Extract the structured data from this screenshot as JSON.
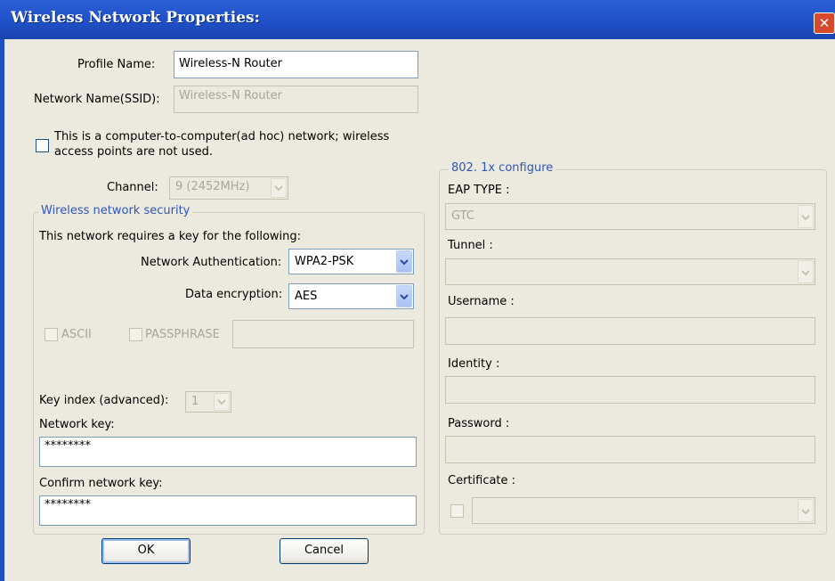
{
  "window": {
    "title": "Wireless Network Properties:",
    "close_glyph": "✕"
  },
  "profile": {
    "label": "Profile Name:",
    "value": "Wireless-N Router"
  },
  "ssid": {
    "label": "Network Name(SSID):",
    "value": "Wireless-N Router"
  },
  "adhoc": {
    "line1": "This is a computer-to-computer(ad hoc) network; wireless",
    "line2": "access points are not used.",
    "checked": false
  },
  "channel": {
    "label": "Channel:",
    "value": "9  (2452MHz)"
  },
  "security": {
    "legend": "Wireless network security",
    "requires_text": "This network requires a key for the following:",
    "auth_label": "Network Authentication:",
    "auth_value": "WPA2-PSK",
    "enc_label": "Data encryption:",
    "enc_value": "AES",
    "ascii_label": "ASCII",
    "passphrase_label": "PASSPHRASE",
    "passphrase_value": "",
    "key_index_label": "Key index (advanced):",
    "key_index_value": "1",
    "network_key_label": "Network key:",
    "network_key_value": "********",
    "confirm_key_label": "Confirm network key:",
    "confirm_key_value": "********"
  },
  "eap": {
    "legend": "802. 1x configure",
    "eap_type_label": "EAP TYPE :",
    "eap_type_value": "GTC",
    "tunnel_label": "Tunnel :",
    "tunnel_value": "",
    "username_label": "Username :",
    "username_value": "",
    "identity_label": "Identity :",
    "identity_value": "",
    "password_label": "Password :",
    "password_value": "",
    "certificate_label": "Certificate :",
    "certificate_value": ""
  },
  "buttons": {
    "ok": "OK",
    "cancel": "Cancel"
  },
  "colors": {
    "titlebar": "#1f4fc6",
    "legend": "#2f55b8",
    "dialog_bg": "#eceadf"
  }
}
